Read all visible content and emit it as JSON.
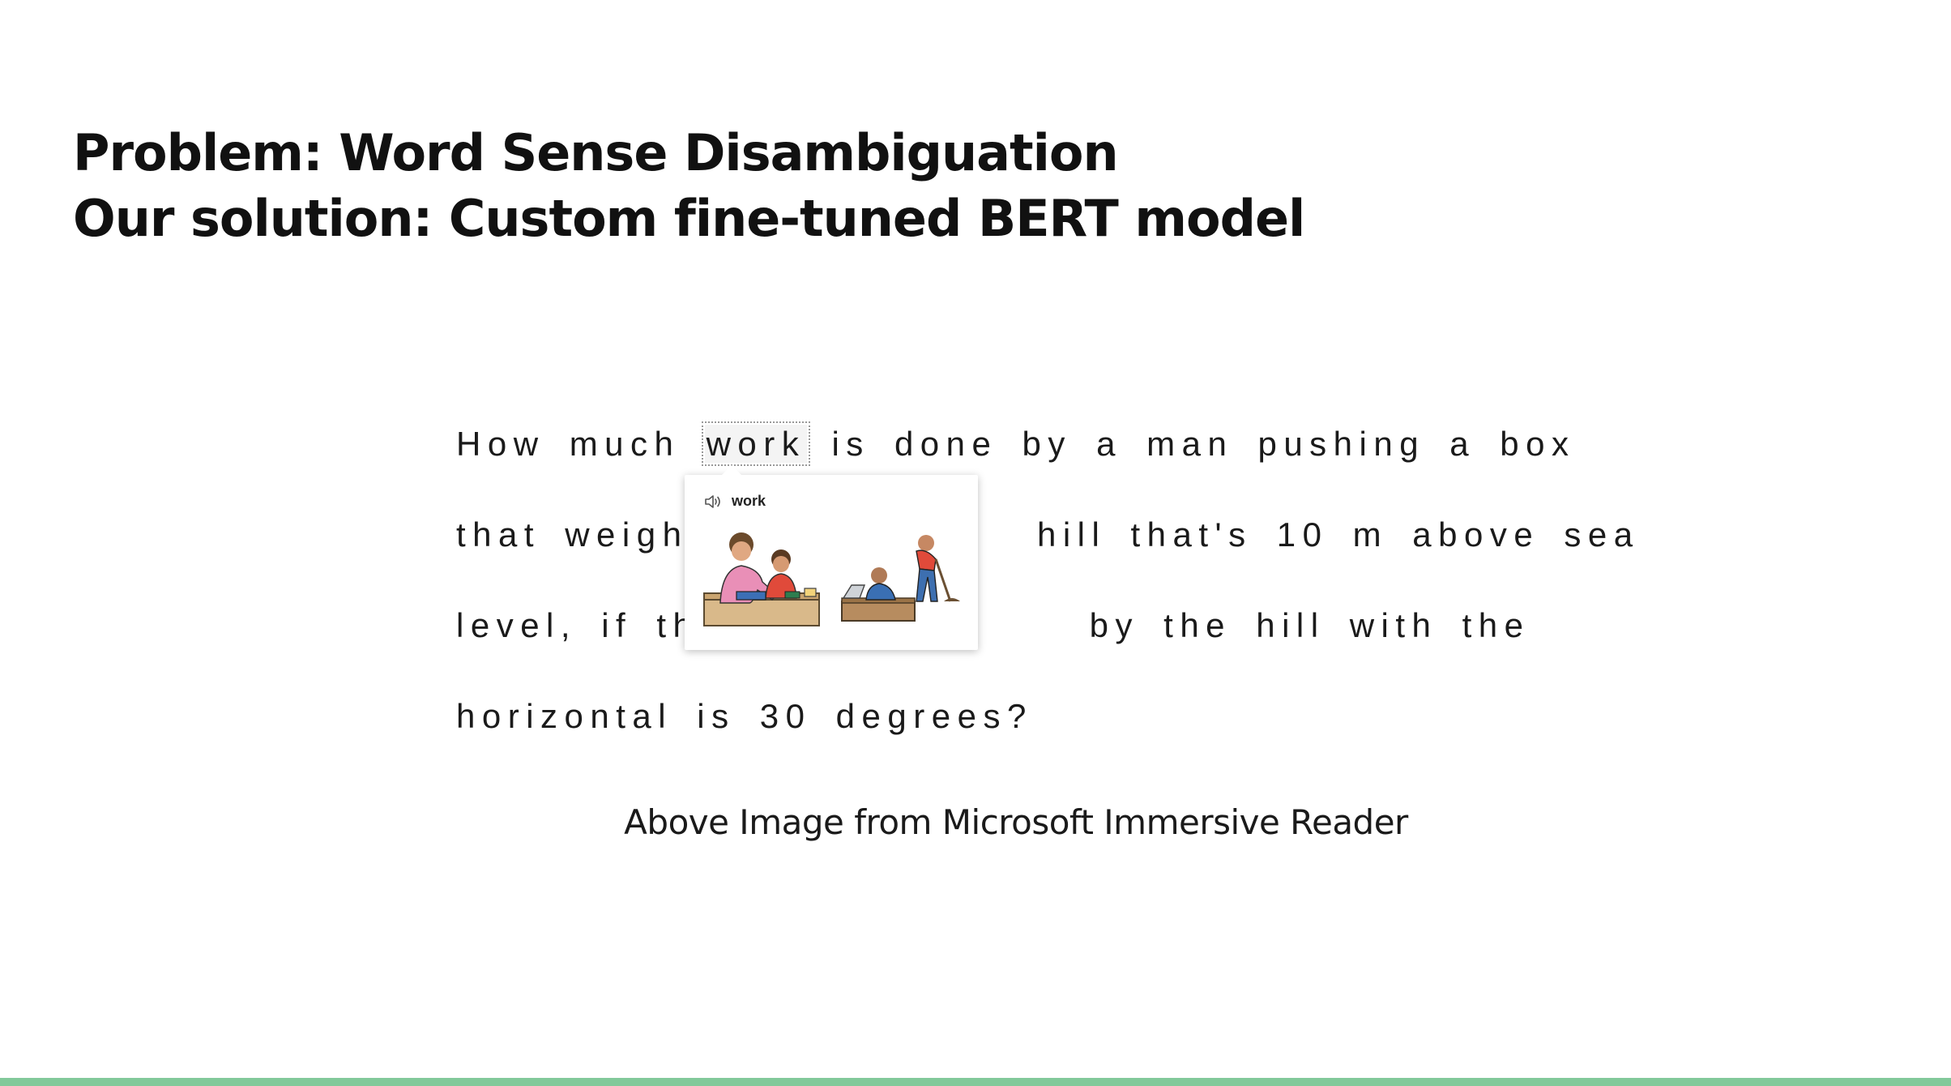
{
  "slide": {
    "title_line_1": "Problem: Word Sense Disambiguation",
    "title_line_2": "Our solution: Custom fine-tuned BERT model",
    "caption": "Above Image from Microsoft Immersive Reader",
    "accent_color": "#82c99a"
  },
  "reader": {
    "line1_before": "How much",
    "highlighted_word": "work",
    "line1_after": "is done by a man pushing a box",
    "line2_left": "that weight",
    "line2_right": "hill that's 10 m above sea",
    "line3_left": "level, if the",
    "line3_right": "by the hill with the",
    "line4": "horizontal is 30 degrees?"
  },
  "popup": {
    "word": "work",
    "icons": [
      "speaker-icon"
    ],
    "images": [
      "homework-illustration",
      "office-and-digging-illustration"
    ]
  }
}
